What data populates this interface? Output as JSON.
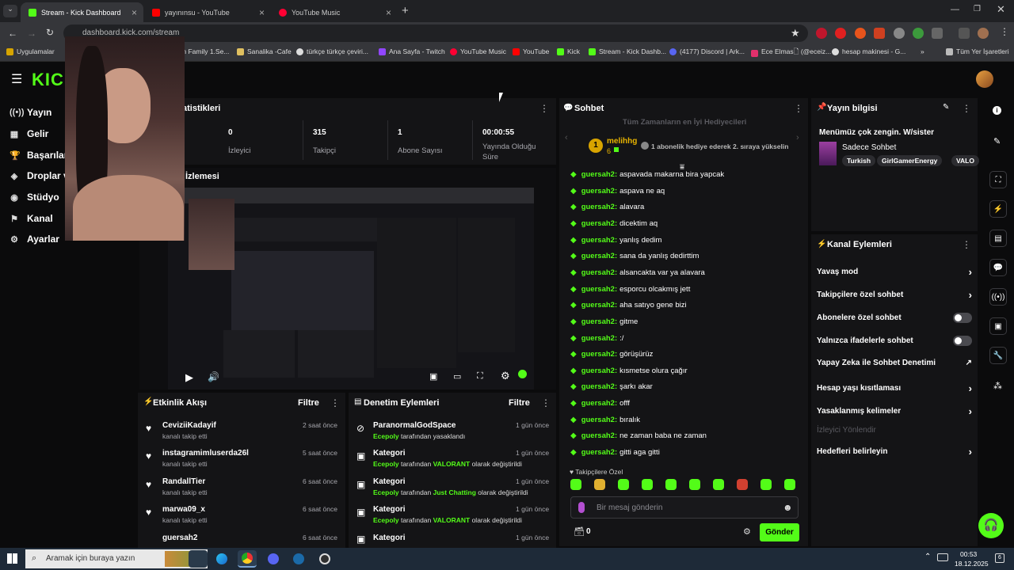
{
  "browser": {
    "tabs": [
      {
        "label": "Stream - Kick Dashboard",
        "color": "#53fc18"
      },
      {
        "label": "yayınınsu - YouTube",
        "color": "#ff0000"
      },
      {
        "label": "YouTube Music",
        "color": "#ff0033"
      }
    ],
    "new_tab": "+",
    "url": "dashboard.kick.com/stream",
    "bookmarks": [
      "Uygulamalar",
      "m Family 1.Se...",
      "Sanalika -Cafe",
      "türkçe türkçe çeviri...",
      "Ana Sayfa - Twitch",
      "YouTube Music",
      "YouTube",
      "Kick",
      "Stream - Kick Dashb...",
      "(4177) Discord | Ark...",
      "Ece Elmas🗋 (@eceiz...",
      "hesap makinesi - G...",
      "»",
      "Tüm Yer İşaretleri"
    ]
  },
  "kick": {
    "logo": "KICK",
    "accent": "#53fc18",
    "nav": [
      {
        "label": "Yayın",
        "icon": "broadcast-icon"
      },
      {
        "label": "Gelir",
        "icon": "money-icon"
      },
      {
        "label": "Başarılar",
        "icon": "trophy-icon"
      },
      {
        "label": "Droplar v",
        "icon": "drops-icon"
      },
      {
        "label": "Stüdyo",
        "icon": "studio-icon"
      },
      {
        "label": "Kanal",
        "icon": "channel-icon"
      },
      {
        "label": "Ayarlar",
        "icon": "gear-icon"
      }
    ],
    "stats": {
      "title": "atistikleri",
      "items": [
        {
          "value": "0",
          "label": "İzleyici"
        },
        {
          "value": "315",
          "label": "Takipçi"
        },
        {
          "value": "1",
          "label": "Abone Sayısı"
        },
        {
          "value": "00:00:55",
          "label": "Yayında Olduğu Süre"
        }
      ]
    },
    "preview": {
      "title": "İzlemesi"
    },
    "activity": {
      "title": "Etkinlik Akışı",
      "filter": "Filtre",
      "items": [
        {
          "name": "CeviziiKadayif",
          "sub": "kanalı takip etti",
          "time": "2 saat önce"
        },
        {
          "name": "instagramimluserda26l",
          "sub": "kanalı takip etti",
          "time": "5 saat önce"
        },
        {
          "name": "RandallTier",
          "sub": "kanalı takip etti",
          "time": "6 saat önce"
        },
        {
          "name": "marwa09_x",
          "sub": "kanalı takip etti",
          "time": "6 saat önce"
        },
        {
          "name": "guersah2",
          "sub": "",
          "time": "6 saat önce"
        }
      ]
    },
    "moderation": {
      "title": "Denetim Eylemleri",
      "filter": "Filtre",
      "items": [
        {
          "title": "ParanormalGodSpace",
          "actor": "Ecepoly",
          "mid": " tarafından yasaklandı",
          "target": "",
          "tail": "",
          "time": "1 gün önce"
        },
        {
          "title": "Kategori",
          "actor": "Ecepoly",
          "mid": " tarafından ",
          "target": "VALORANT",
          "tail": " olarak değiştirildi",
          "time": "1 gün önce"
        },
        {
          "title": "Kategori",
          "actor": "Ecepoly",
          "mid": " tarafından ",
          "target": "Just Chatting",
          "tail": " olarak değiştirildi",
          "time": "1 gün önce"
        },
        {
          "title": "Kategori",
          "actor": "Ecepoly",
          "mid": " tarafından ",
          "target": "VALORANT",
          "tail": " olarak değiştirildi",
          "time": "1 gün önce"
        },
        {
          "title": "Kategori",
          "actor": "",
          "mid": "",
          "target": "",
          "tail": "",
          "time": "1 gün önce"
        }
      ]
    },
    "chat": {
      "title": "Sohbet",
      "gifters_title": "Tüm Zamanların en İyi Hediyecileri",
      "top_gifter": {
        "rank": "1",
        "name": "melihhg",
        "count": "6"
      },
      "gifter_note": "1 abonelik hediye ederek 2. sıraya yükselin",
      "messages": [
        {
          "user": "guersah2:",
          "text": "aspavada makarna bira yapcak"
        },
        {
          "user": "guersah2:",
          "text": "aspava ne aq"
        },
        {
          "user": "guersah2:",
          "text": "alavara"
        },
        {
          "user": "guersah2:",
          "text": "dicektim aq"
        },
        {
          "user": "guersah2:",
          "text": "yanlış dedim"
        },
        {
          "user": "guersah2:",
          "text": "sana da yanlış dedirttim"
        },
        {
          "user": "guersah2:",
          "text": "alsancakta var ya alavara"
        },
        {
          "user": "guersah2:",
          "text": "esporcu olcakmış jett"
        },
        {
          "user": "guersah2:",
          "text": "aha satıyo gene bizi"
        },
        {
          "user": "guersah2:",
          "text": "gitme"
        },
        {
          "user": "guersah2:",
          "text": ":/"
        },
        {
          "user": "guersah2:",
          "text": "görüşürüz"
        },
        {
          "user": "guersah2:",
          "text": "kısmetse olura çağır"
        },
        {
          "user": "guersah2:",
          "text": "şarkı akar"
        },
        {
          "user": "guersah2:",
          "text": "offf"
        },
        {
          "user": "guersah2:",
          "text": "bıralık"
        },
        {
          "user": "guersah2:",
          "text": "ne zaman baba ne zaman"
        },
        {
          "user": "guersah2:",
          "text": "gitti aga gitti"
        }
      ],
      "followers_only": "Takipçilere Özel",
      "input_placeholder": "Bir mesaj gönderin",
      "points": "0",
      "send": "Gönder"
    },
    "stream_info": {
      "title": "Yayın bilgisi",
      "stream_title": "Menümüz çok zengin. W/sister",
      "category": "Sadece Sohbet",
      "tags": [
        "Turkish",
        "GirlGamerEnergy",
        "VALO"
      ]
    },
    "channel_actions": {
      "title": "Kanal Eylemleri",
      "items": [
        {
          "label": "Yavaş mod",
          "control": "chevron"
        },
        {
          "label": "Takipçilere özel sohbet",
          "control": "chevron"
        },
        {
          "label": "Abonelere özel sohbet",
          "control": "toggle"
        },
        {
          "label": "Yalnızca ifadelerle sohbet",
          "control": "toggle"
        },
        {
          "label": "Yapay Zeka ile Sohbet Denetimi",
          "control": "external"
        },
        {
          "label": "Hesap yaşı kısıtlaması",
          "control": "chevron"
        },
        {
          "label": "Yasaklanmış kelimeler",
          "control": "chevron"
        },
        {
          "label": "İzleyici Yönlendir",
          "control": "disabled"
        },
        {
          "label": "Hedefleri belirleyin",
          "control": "chevron"
        }
      ]
    }
  },
  "taskbar": {
    "search_placeholder": "Aramak için buraya yazın",
    "time": "00:53",
    "date": "18.12.2025",
    "notification_count": "6"
  }
}
